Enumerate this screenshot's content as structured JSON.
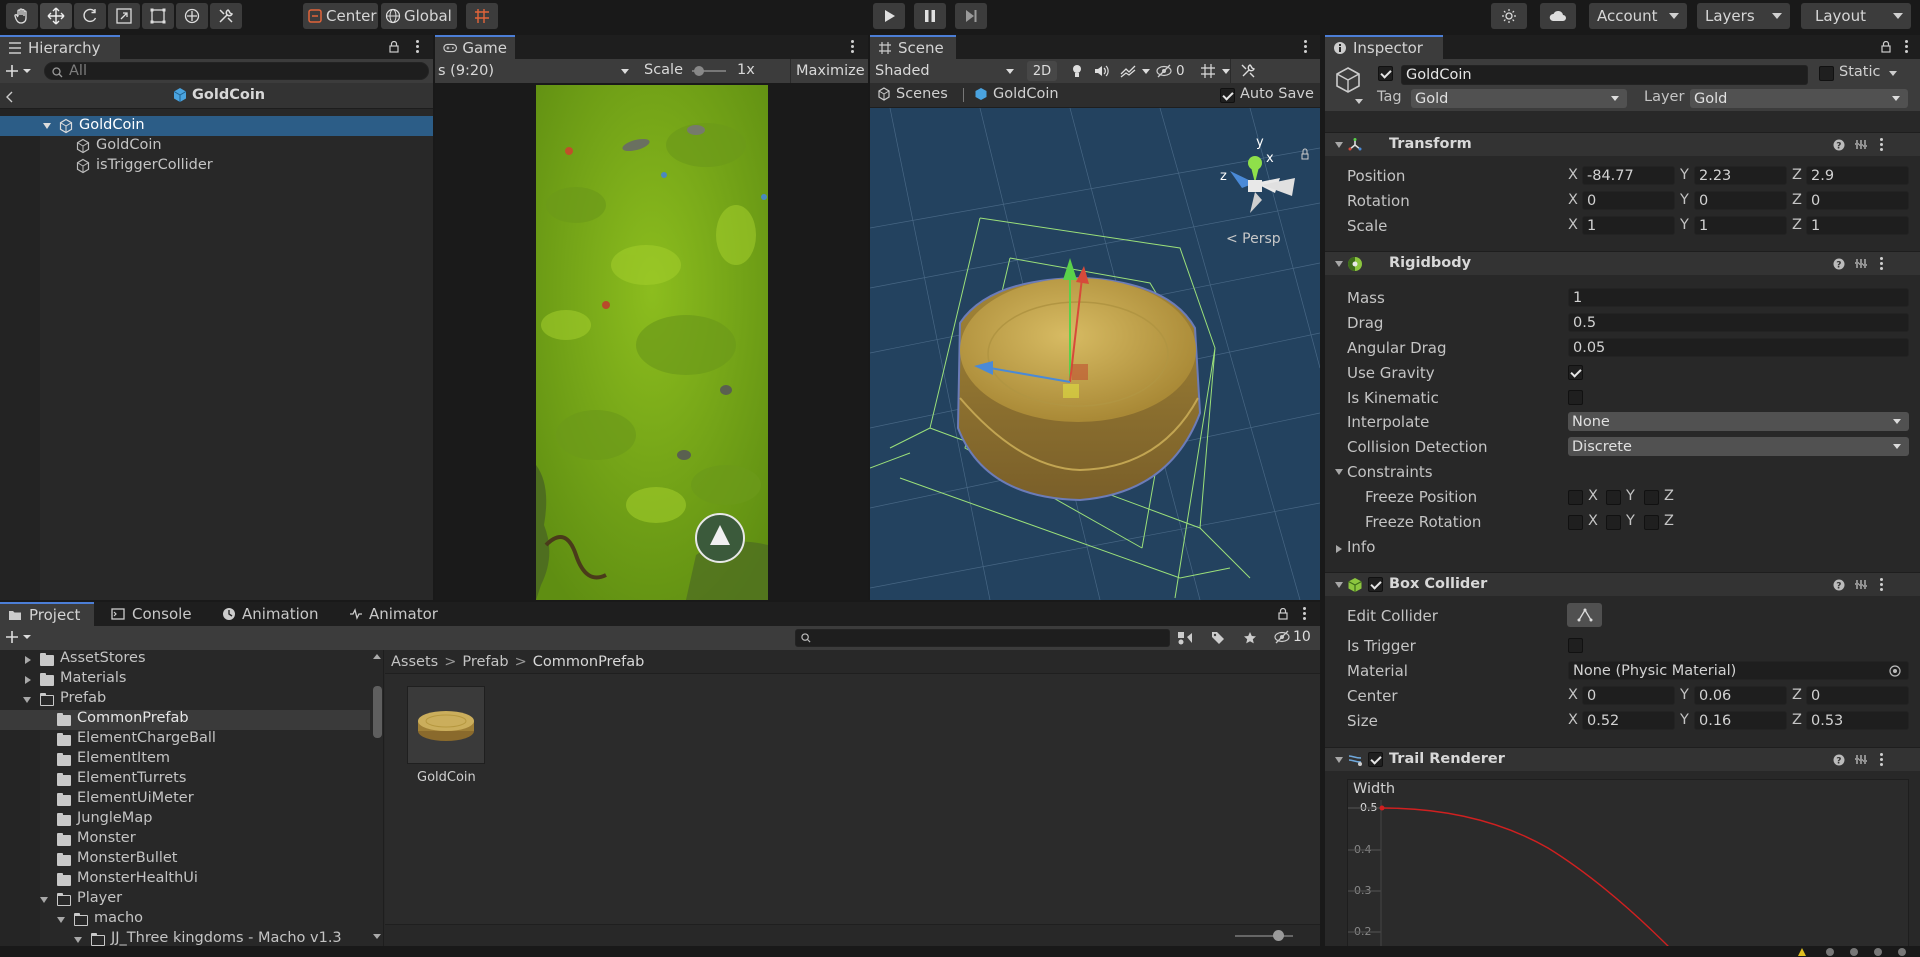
{
  "toolbar": {
    "pivot_label": "Center",
    "space_label": "Global",
    "account_label": "Account",
    "layers_label": "Layers",
    "layout_label": "Layout"
  },
  "hierarchy": {
    "tab_label": "Hierarchy",
    "search_placeholder": "All",
    "scene_title": "GoldCoin",
    "items": [
      {
        "label": "GoldCoin"
      },
      {
        "label": "GoldCoin"
      },
      {
        "label": "isTriggerCollider"
      }
    ]
  },
  "game": {
    "tab_label": "Game",
    "resolution": "s (9:20)",
    "scale_label": "Scale",
    "scale_value": "1x",
    "maximize_label": "Maximize"
  },
  "scene": {
    "tab_label": "Scene",
    "shading": "Shaded",
    "mode_2d": "2D",
    "hidden_count": "0",
    "breadcrumb_root": "Scenes",
    "breadcrumb_prefab": "GoldCoin",
    "auto_save_label": "Auto Save",
    "persp_label": "< Persp",
    "gizmo_y": "y",
    "gizmo_x": "x",
    "gizmo_z": "z"
  },
  "inspector": {
    "tab_label": "Inspector",
    "object_name": "GoldCoin",
    "static_label": "Static",
    "tag_label": "Tag",
    "tag_value": "Gold",
    "layer_label": "Layer",
    "layer_value": "Gold",
    "transform": {
      "title": "Transform",
      "position_label": "Position",
      "rotation_label": "Rotation",
      "scale_label": "Scale",
      "position": {
        "x": "-84.77",
        "y": "2.23",
        "z": "2.9"
      },
      "rotation": {
        "x": "0",
        "y": "0",
        "z": "0"
      },
      "scale": {
        "x": "1",
        "y": "1",
        "z": "1"
      }
    },
    "rigidbody": {
      "title": "Rigidbody",
      "mass_label": "Mass",
      "mass": "1",
      "drag_label": "Drag",
      "drag": "0.5",
      "angular_drag_label": "Angular Drag",
      "angular_drag": "0.05",
      "use_gravity_label": "Use Gravity",
      "use_gravity": true,
      "is_kinematic_label": "Is Kinematic",
      "is_kinematic": false,
      "interpolate_label": "Interpolate",
      "interpolate": "None",
      "collision_label": "Collision Detection",
      "collision": "Discrete",
      "constraints_label": "Constraints",
      "freeze_position_label": "Freeze Position",
      "freeze_rotation_label": "Freeze Rotation",
      "info_label": "Info"
    },
    "box_collider": {
      "title": "Box Collider",
      "edit_label": "Edit Collider",
      "is_trigger_label": "Is Trigger",
      "material_label": "Material",
      "material": "None (Physic Material)",
      "center_label": "Center",
      "size_label": "Size",
      "center": {
        "x": "0",
        "y": "0.06",
        "z": "0"
      },
      "size": {
        "x": "0.52",
        "y": "0.16",
        "z": "0.53"
      }
    },
    "trail": {
      "title": "Trail Renderer",
      "width_label": "Width",
      "ticks": [
        "0.5",
        "0.4",
        "0.3",
        "0.2"
      ]
    },
    "axis_x": "X",
    "axis_y": "Y",
    "axis_z": "Z"
  },
  "project": {
    "tabs": [
      "Project",
      "Console",
      "Animation",
      "Animator"
    ],
    "hidden_count": "10",
    "breadcrumb": [
      "Assets",
      "Prefab",
      "CommonPrefab"
    ],
    "tree": [
      {
        "label": "AssetStores"
      },
      {
        "label": "Materials"
      },
      {
        "label": "Prefab"
      },
      {
        "label": "CommonPrefab"
      },
      {
        "label": "ElementChargeBall"
      },
      {
        "label": "ElementItem"
      },
      {
        "label": "ElementTurrets"
      },
      {
        "label": "ElementUiMeter"
      },
      {
        "label": "JungleMap"
      },
      {
        "label": "Monster"
      },
      {
        "label": "MonsterBullet"
      },
      {
        "label": "MonsterHealthUi"
      },
      {
        "label": "Player"
      },
      {
        "label": "macho"
      },
      {
        "label": "JJ_Three kingdoms - Macho v1.3"
      }
    ],
    "asset_name": "GoldCoin"
  },
  "colors": {
    "accent": "#2c5d87",
    "selected_row": "#2c5d87",
    "panel": "#282828",
    "scene_bg": "#23425f",
    "coin": "#c7a84a"
  }
}
